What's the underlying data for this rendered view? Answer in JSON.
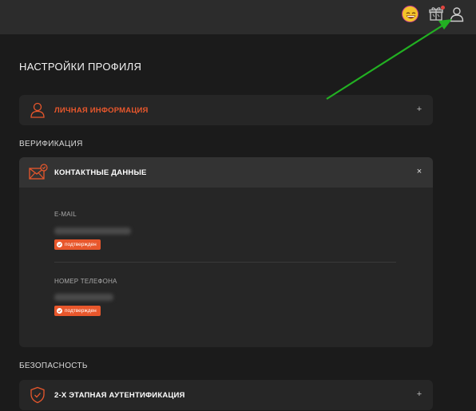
{
  "header": {
    "avatar_icon": "grinning-face-emoji-icon",
    "gift_icon": "gift-box-icon",
    "user_icon": "user-profile-icon",
    "notification_color": "#e0453f"
  },
  "page": {
    "title": "НАСТРОЙКИ ПРОФИЛЯ"
  },
  "personal": {
    "title": "ЛИЧНАЯ ИНФОРМАЦИЯ",
    "icon": "user-outline-icon",
    "toggle": "+",
    "title_color": "#e8572c"
  },
  "verification": {
    "label": "ВЕРИФИКАЦИЯ",
    "card": {
      "title": "КОНТАКТНЫЕ ДАННЫЕ",
      "icon": "mail-icon",
      "toggle": "×",
      "email": {
        "label": "E-MAIL",
        "value": "",
        "status": "подтвержден"
      },
      "phone": {
        "label": "НОМЕР ТЕЛЕФОНА",
        "value": "",
        "status": "подтвержден"
      }
    }
  },
  "security": {
    "label": "БЕЗОПАСНОСТЬ",
    "card": {
      "title": "2-Х ЭТАПНАЯ АУТЕНТИФИКАЦИЯ",
      "icon": "shield-check-icon",
      "toggle": "+"
    }
  },
  "colors": {
    "accent": "#e8572c",
    "annotation_arrow": "#22b022"
  }
}
